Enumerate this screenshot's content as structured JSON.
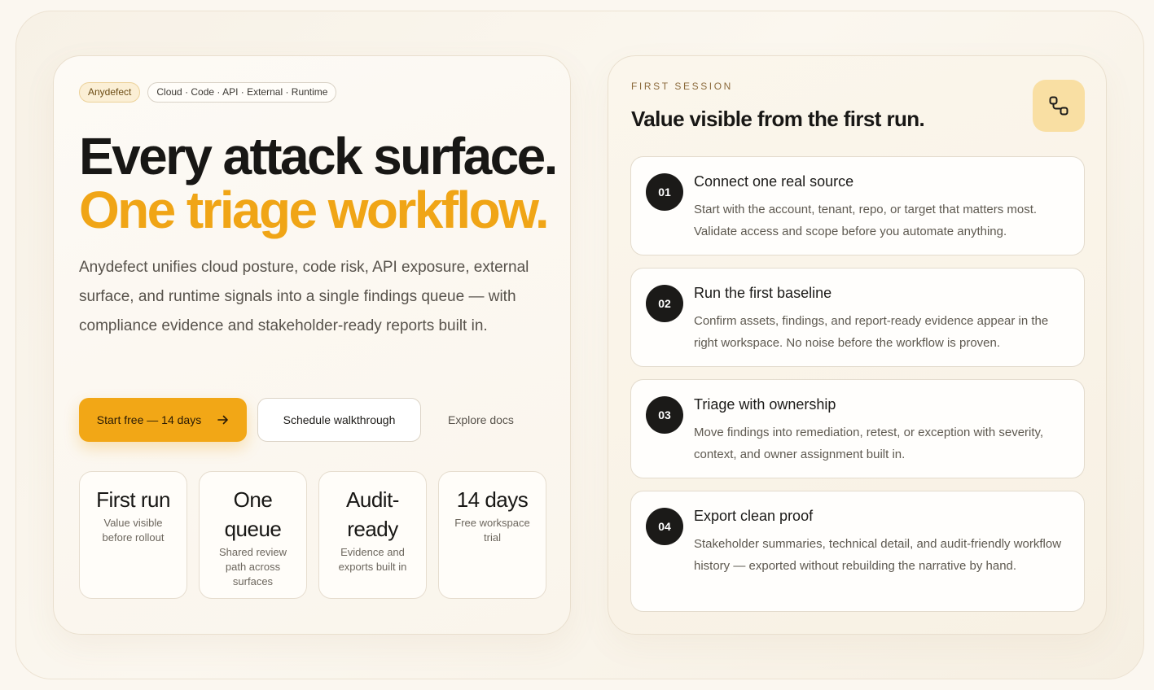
{
  "hero": {
    "brand_chip": "Anydefect",
    "surfaces_chip": "Cloud · Code · API · External · Runtime",
    "headline_line1": "Every attack surface.",
    "headline_line2": "One triage workflow.",
    "lede": "Anydefect unifies cloud posture, code risk, API exposure, external surface, and runtime signals into a single findings queue — with compliance evidence and stakeholder-ready reports built in.",
    "cta_primary": "Start free — 14 days",
    "cta_primary_icon": "arrow-right-icon",
    "cta_secondary": "Schedule walkthrough",
    "cta_link": "Explore docs",
    "stats": [
      {
        "value": "First run",
        "caption": "Value visible before rollout"
      },
      {
        "value": "One queue",
        "caption": "Shared review path across surfaces"
      },
      {
        "value": "Audit-ready",
        "caption": "Evidence and exports built in"
      },
      {
        "value": "14 days",
        "caption": "Free workspace trial"
      }
    ]
  },
  "session": {
    "eyebrow": "FIRST SESSION",
    "title": "Value visible from the first run.",
    "badge_icon": "connected-nodes-icon",
    "steps": [
      {
        "num": "01",
        "title": "Connect one real source",
        "body": "Start with the account, tenant, repo, or target that matters most. Validate access and scope before you automate anything."
      },
      {
        "num": "02",
        "title": "Run the first baseline",
        "body": "Confirm assets, findings, and report-ready evidence appear in the right workspace. No noise before the workflow is proven."
      },
      {
        "num": "03",
        "title": "Triage with ownership",
        "body": "Move findings into remediation, retest, or exception with severity, context, and owner assignment built in."
      },
      {
        "num": "04",
        "title": "Export clean proof",
        "body": "Stakeholder summaries, technical detail, and audit-friendly workflow history — exported without rebuilding the narrative by hand."
      }
    ]
  },
  "colors": {
    "accent": "#f2a716",
    "ink": "#181715",
    "badge": "#f9dfa3"
  }
}
